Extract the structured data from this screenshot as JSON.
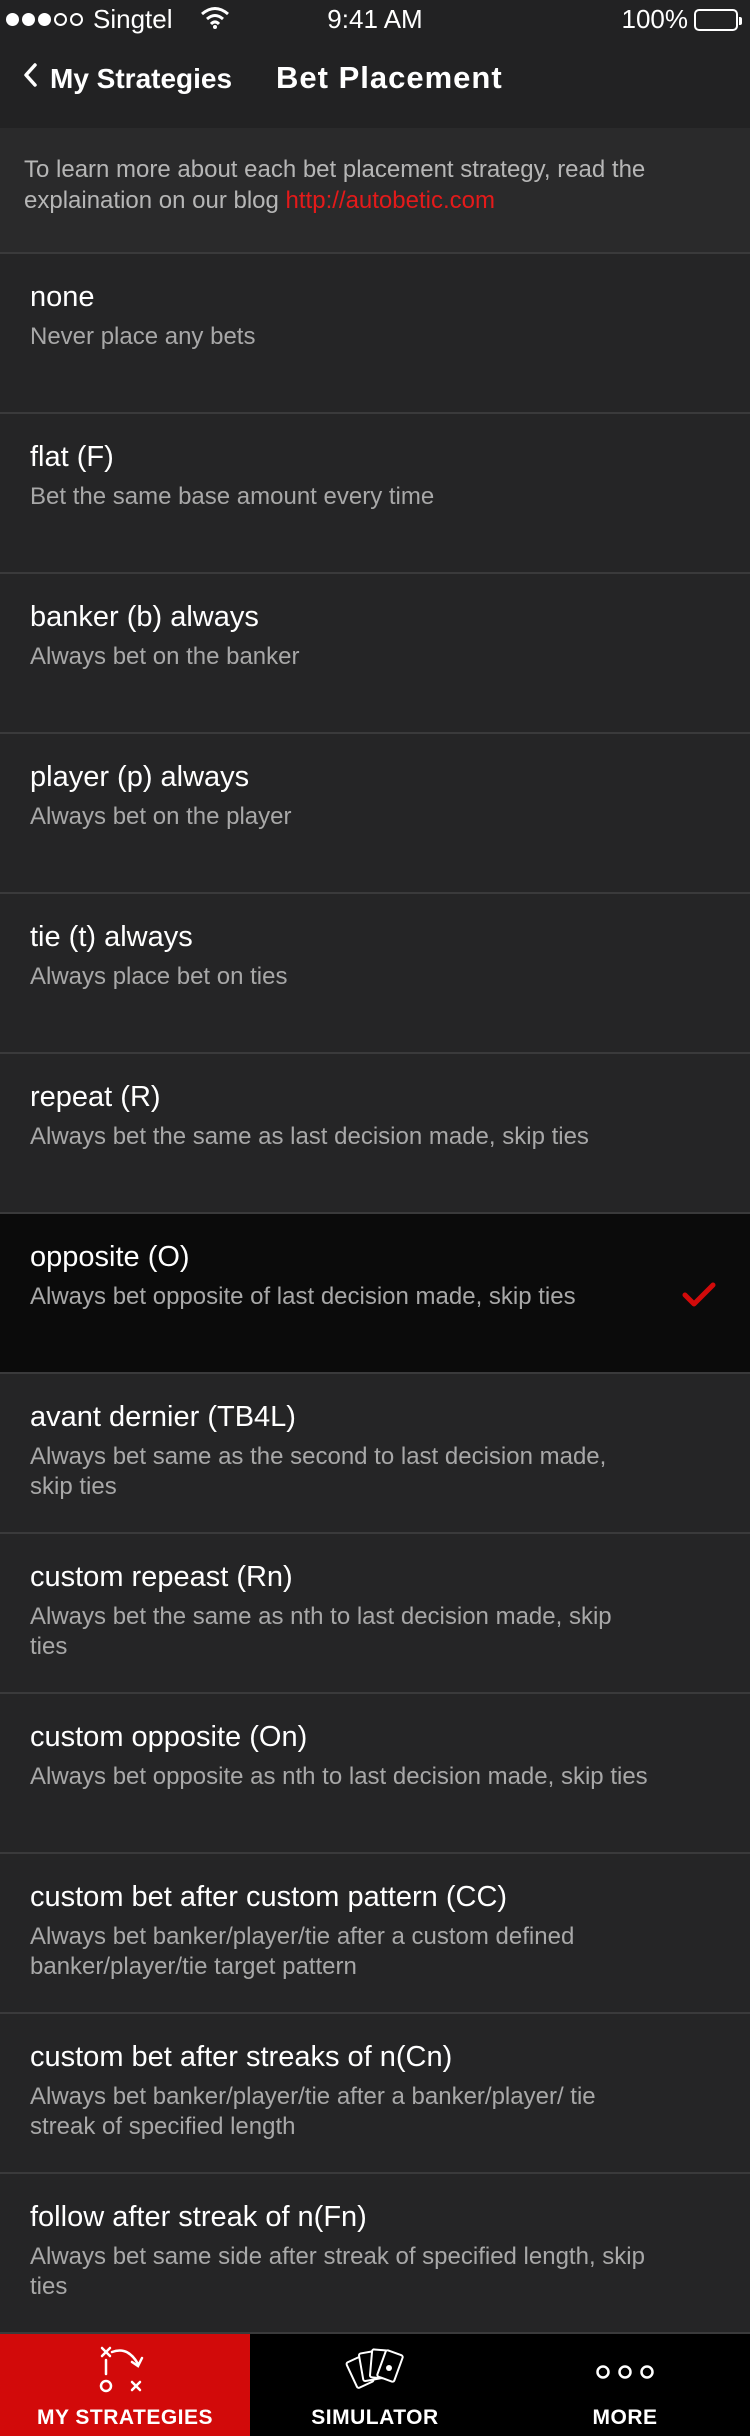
{
  "status_bar": {
    "carrier": "Singtel",
    "time": "9:41 AM",
    "battery": "100%"
  },
  "nav": {
    "back_label": "My Strategies",
    "title": "Bet Placement"
  },
  "intro": {
    "text": "To learn more about each bet placement strategy, read the explaination on our blog ",
    "link": "http://autobetic.com"
  },
  "strategies": [
    {
      "title": "none",
      "description": "Never place any bets"
    },
    {
      "title": "flat (F)",
      "description": "Bet the same base amount every time"
    },
    {
      "title": "banker (b) always",
      "description": "Always bet on the banker"
    },
    {
      "title": "player (p) always",
      "description": "Always bet on the player"
    },
    {
      "title": "tie (t) always",
      "description": "Always place bet on ties"
    },
    {
      "title": "repeat (R)",
      "description": "Always bet the same as last decision made, skip ties"
    },
    {
      "title": "opposite (O)",
      "description": "Always bet opposite of last decision made, skip ties"
    },
    {
      "title": "avant dernier (TB4L)",
      "description": "Always bet same as the second to last decision made, skip ties"
    },
    {
      "title": "custom repeast (Rn)",
      "description": "Always bet the same as nth to last decision made, skip ties"
    },
    {
      "title": "custom opposite (On)",
      "description": "Always bet opposite as nth to last decision made, skip ties"
    },
    {
      "title": "custom bet after custom pattern (CC)",
      "description": "Always bet banker/player/tie after a custom defined banker/player/tie target pattern"
    },
    {
      "title": "custom bet after streaks of n(Cn)",
      "description": "Always bet banker/player/tie after a banker/player/ tie streak of specified length"
    },
    {
      "title": "follow after streak of n(Fn)",
      "description": "Always bet same side after streak of specified length, skip ties"
    }
  ],
  "selected_index": 6,
  "tabs": [
    {
      "label": "MY STRATEGIES",
      "icon": "strategy-play-icon",
      "active": true
    },
    {
      "label": "SIMULATOR",
      "icon": "playing-cards-icon",
      "active": false
    },
    {
      "label": "MORE",
      "icon": "more-dots-icon",
      "active": false
    }
  ],
  "colors": {
    "accent": "#d20a0a",
    "link": "#e41a1a",
    "background": "#1f1f20",
    "selected_row": "#0b0b0b"
  }
}
